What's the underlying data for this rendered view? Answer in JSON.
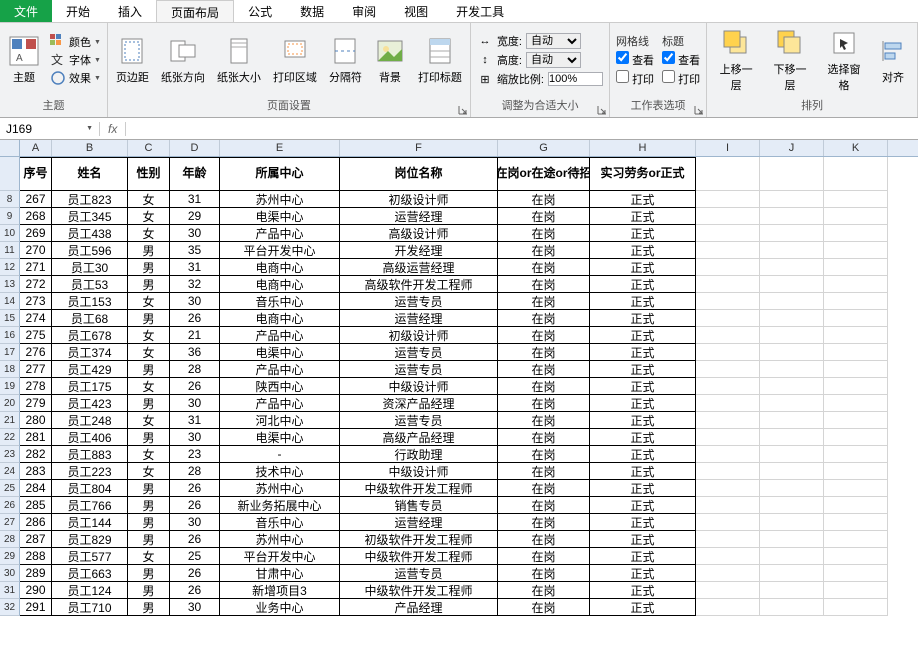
{
  "tabs": {
    "file": "文件",
    "home": "开始",
    "insert": "插入",
    "layout": "页面布局",
    "formula": "公式",
    "data": "数据",
    "review": "审阅",
    "view": "视图",
    "dev": "开发工具"
  },
  "ribbon": {
    "theme": {
      "colors": "颜色",
      "fonts": "字体",
      "effects": "效果",
      "label": "主题"
    },
    "pagesetup": {
      "margins": "页边距",
      "orient": "纸张方向",
      "size": "纸张大小",
      "printarea": "打印区域",
      "breaks": "分隔符",
      "bg": "背景",
      "titles": "打印标题",
      "label": "页面设置"
    },
    "adjust": {
      "width": "宽度:",
      "height": "高度:",
      "scale": "缩放比例:",
      "auto": "自动",
      "pct": "100%",
      "label": "调整为合适大小"
    },
    "sheetopts": {
      "grid": "网格线",
      "headings": "标题",
      "view": "查看",
      "print": "打印",
      "label": "工作表选项"
    },
    "arrange": {
      "fwd": "上移一层",
      "back": "下移一层",
      "selpane": "选择窗格",
      "align": "对齐",
      "label": "排列"
    }
  },
  "namebox": "J169",
  "columns": [
    "A",
    "B",
    "C",
    "D",
    "E",
    "F",
    "G",
    "H",
    "I",
    "J",
    "K"
  ],
  "headers": [
    "序号",
    "姓名",
    "性别",
    "年龄",
    "所属中心",
    "岗位名称",
    "在岗or在途or待招",
    "实习劳务or正式"
  ],
  "row_start": 8,
  "chart_data": {
    "type": "table",
    "columns": [
      "序号",
      "姓名",
      "性别",
      "年龄",
      "所属中心",
      "岗位名称",
      "在岗or在途or待招",
      "实习劳务or正式"
    ],
    "rows": [
      [
        "267",
        "员工823",
        "女",
        "31",
        "苏州中心",
        "初级设计师",
        "在岗",
        "正式"
      ],
      [
        "268",
        "员工345",
        "女",
        "29",
        "电渠中心",
        "运营经理",
        "在岗",
        "正式"
      ],
      [
        "269",
        "员工438",
        "女",
        "30",
        "产品中心",
        "高级设计师",
        "在岗",
        "正式"
      ],
      [
        "270",
        "员工596",
        "男",
        "35",
        "平台开发中心",
        "开发经理",
        "在岗",
        "正式"
      ],
      [
        "271",
        "员工30",
        "男",
        "31",
        "电商中心",
        "高级运营经理",
        "在岗",
        "正式"
      ],
      [
        "272",
        "员工53",
        "男",
        "32",
        "电商中心",
        "高级软件开发工程师",
        "在岗",
        "正式"
      ],
      [
        "273",
        "员工153",
        "女",
        "30",
        "音乐中心",
        "运营专员",
        "在岗",
        "正式"
      ],
      [
        "274",
        "员工68",
        "男",
        "26",
        "电商中心",
        "运营经理",
        "在岗",
        "正式"
      ],
      [
        "275",
        "员工678",
        "女",
        "21",
        "产品中心",
        "初级设计师",
        "在岗",
        "正式"
      ],
      [
        "276",
        "员工374",
        "女",
        "36",
        "电渠中心",
        "运营专员",
        "在岗",
        "正式"
      ],
      [
        "277",
        "员工429",
        "男",
        "28",
        "产品中心",
        "运营专员",
        "在岗",
        "正式"
      ],
      [
        "278",
        "员工175",
        "女",
        "26",
        "陕西中心",
        "中级设计师",
        "在岗",
        "正式"
      ],
      [
        "279",
        "员工423",
        "男",
        "30",
        "产品中心",
        "资深产品经理",
        "在岗",
        "正式"
      ],
      [
        "280",
        "员工248",
        "女",
        "31",
        "河北中心",
        "运营专员",
        "在岗",
        "正式"
      ],
      [
        "281",
        "员工406",
        "男",
        "30",
        "电渠中心",
        "高级产品经理",
        "在岗",
        "正式"
      ],
      [
        "282",
        "员工883",
        "女",
        "23",
        "-",
        "行政助理",
        "在岗",
        "正式"
      ],
      [
        "283",
        "员工223",
        "女",
        "28",
        "技术中心",
        "中级设计师",
        "在岗",
        "正式"
      ],
      [
        "284",
        "员工804",
        "男",
        "26",
        "苏州中心",
        "中级软件开发工程师",
        "在岗",
        "正式"
      ],
      [
        "285",
        "员工766",
        "男",
        "26",
        "新业务拓展中心",
        "销售专员",
        "在岗",
        "正式"
      ],
      [
        "286",
        "员工144",
        "男",
        "30",
        "音乐中心",
        "运营经理",
        "在岗",
        "正式"
      ],
      [
        "287",
        "员工829",
        "男",
        "26",
        "苏州中心",
        "初级软件开发工程师",
        "在岗",
        "正式"
      ],
      [
        "288",
        "员工577",
        "女",
        "25",
        "平台开发中心",
        "中级软件开发工程师",
        "在岗",
        "正式"
      ],
      [
        "289",
        "员工663",
        "男",
        "26",
        "甘肃中心",
        "运营专员",
        "在岗",
        "正式"
      ],
      [
        "290",
        "员工124",
        "男",
        "26",
        "新增项目3",
        "中级软件开发工程师",
        "在岗",
        "正式"
      ],
      [
        "291",
        "员工710",
        "男",
        "30",
        "业务中心",
        "产品经理",
        "在岗",
        "正式"
      ]
    ]
  }
}
